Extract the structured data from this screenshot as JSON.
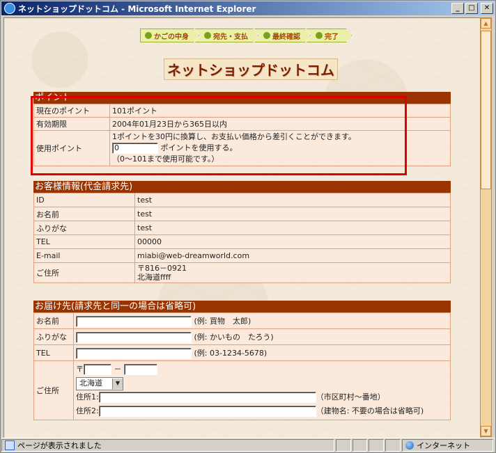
{
  "window": {
    "title": "ネットショップドットコム - Microsoft Internet Explorer",
    "minimize": "_",
    "maximize": "□",
    "close": "✕"
  },
  "steps": [
    "かごの中身",
    "宛先・支払",
    "最終確認",
    "完了"
  ],
  "site_title": "ネットショップドットコム",
  "points": {
    "heading": "ポイント",
    "rows": [
      {
        "label": "現在のポイント",
        "value": "101ポイント"
      },
      {
        "label": "有効期限",
        "value": "2004年01月23日から365日以内"
      }
    ],
    "use_label": "使用ポイント",
    "use_desc": "1ポイントを30円に換算し、お支払い価格から差引くことができます。",
    "use_value": "0",
    "use_suffix": "ポイントを使用する。",
    "use_range": "（0～101まで使用可能です。）"
  },
  "customer": {
    "heading": "お客様情報(代金請求先)",
    "rows": [
      {
        "label": "ID",
        "value": "test"
      },
      {
        "label": "お名前",
        "value": "test"
      },
      {
        "label": "ふりがな",
        "value": "test"
      },
      {
        "label": "TEL",
        "value": "00000"
      },
      {
        "label": "E-mail",
        "value": "miabi@web-dreamworld.com"
      }
    ],
    "address_label": "ご住所",
    "address_line1": "〒816－0921",
    "address_line2": "北海道ffff"
  },
  "delivery": {
    "heading": "お届け先(請求先と同一の場合は省略可)",
    "name_label": "お名前",
    "name_hint": "(例: 買物　太郎)",
    "kana_label": "ふりがな",
    "kana_hint": "(例: かいもの　たろう)",
    "tel_label": "TEL",
    "tel_hint": "(例: 03-1234-5678)",
    "address_label": "ご住所",
    "zip_mark": "〒",
    "zip_dash": "－",
    "prefecture": "北海道",
    "addr1_label": "住所1:",
    "addr1_hint": "（市区町村～番地）",
    "addr2_label": "住所2:",
    "addr2_hint": "（建物名: 不要の場合は省略可)"
  },
  "status": {
    "text": "ページが表示されました",
    "zone": "インターネット"
  }
}
